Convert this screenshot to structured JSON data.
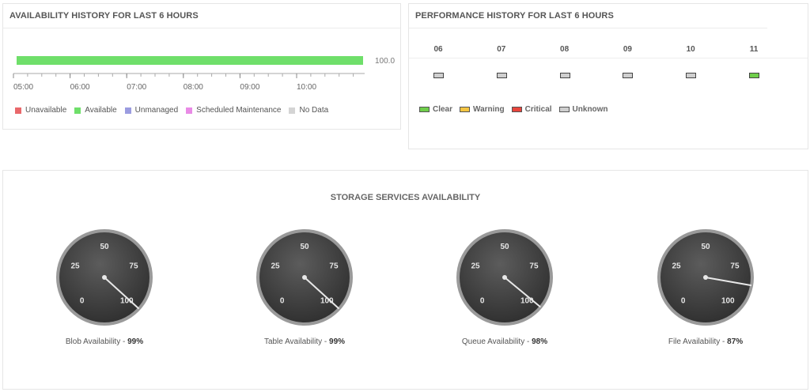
{
  "availability": {
    "title": "AVAILABILITY HISTORY FOR LAST 6 HOURS",
    "bar_value_label": "100.0",
    "available_fraction": 1.0,
    "axis_labels": [
      "05:00",
      "06:00",
      "07:00",
      "08:00",
      "09:00",
      "10:00"
    ],
    "legend": [
      {
        "label": "Unavailable",
        "color": "#e9686b"
      },
      {
        "label": "Available",
        "color": "#6fdf6a"
      },
      {
        "label": "Unmanaged",
        "color": "#9b9ce0"
      },
      {
        "label": "Scheduled Maintenance",
        "color": "#e98be6"
      },
      {
        "label": "No Data",
        "color": "#d4d4d4"
      }
    ]
  },
  "performance": {
    "title": "PERFORMANCE HISTORY FOR LAST 6 HOURS",
    "hours": [
      {
        "label": "06",
        "status_color": "#cfcfcf"
      },
      {
        "label": "07",
        "status_color": "#cfcfcf"
      },
      {
        "label": "08",
        "status_color": "#cfcfcf"
      },
      {
        "label": "09",
        "status_color": "#cfcfcf"
      },
      {
        "label": "10",
        "status_color": "#cfcfcf"
      },
      {
        "label": "11",
        "status_color": "#6fce4b"
      }
    ],
    "legend": [
      {
        "label": "Clear",
        "color": "#6fce4b"
      },
      {
        "label": "Warning",
        "color": "#f4c542"
      },
      {
        "label": "Critical",
        "color": "#e8453c"
      },
      {
        "label": "Unknown",
        "color": "#cfcfcf"
      }
    ]
  },
  "storage": {
    "title": "STORAGE SERVICES AVAILABILITY",
    "gauge_ticks": [
      "0",
      "25",
      "50",
      "75",
      "100"
    ],
    "gauges": [
      {
        "label": "Blob Availability - ",
        "value_text": "99%",
        "value": 99
      },
      {
        "label": "Table Availability - ",
        "value_text": "99%",
        "value": 99
      },
      {
        "label": "Queue Availability - ",
        "value_text": "98%",
        "value": 98
      },
      {
        "label": "File Availability - ",
        "value_text": "87%",
        "value": 87
      }
    ]
  }
}
